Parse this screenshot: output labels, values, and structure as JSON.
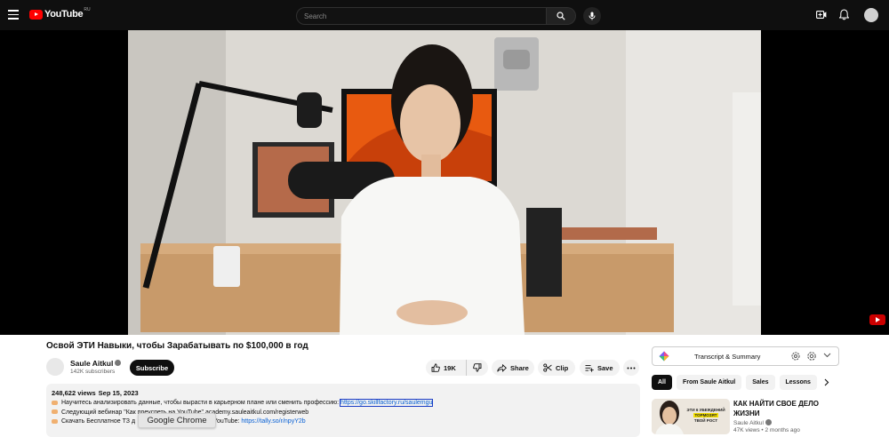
{
  "header": {
    "logo_text": "YouTube",
    "region": "RU",
    "search_placeholder": "Search"
  },
  "video": {
    "title": "Освой ЭТИ Навыки, чтобы Зарабатывать по $100,000 в год"
  },
  "channel": {
    "name": "Saule Aitkul",
    "subscribers": "142K subscribers",
    "subscribe_label": "Subscribe"
  },
  "actions": {
    "likes": "19K",
    "share_label": "Share",
    "clip_label": "Clip",
    "save_label": "Save"
  },
  "description": {
    "views": "248,622 views",
    "date": "Sep 15, 2023",
    "line1_text": "Научитесь анализировать данные, чтобы вырасти в карьерном плане или сменить профессию: ",
    "line1_link": "https://go.skillfactory.ru/saulemgu",
    "line2_text": "Следующий вебинар \"Как преуспеть на YouTube\" academy.sauleaitkul.com/registerweb",
    "line3_text_a": "Скачать Бесплатное ТЗ д",
    "line3_text_b": " YouTube: ",
    "line3_link": "https://tally.so/r/npyY2b"
  },
  "tooltip": {
    "text": "Google Chrome"
  },
  "sidebar": {
    "transcript_label": "Transcript & Summary",
    "chips": [
      "All",
      "From Saule Aitkul",
      "Sales",
      "Lessons"
    ],
    "rec": {
      "title": "КАК НАЙТИ СВОЕ ДЕЛО ЖИЗНИ",
      "channel": "Saule Aitkul",
      "meta": "47K views • 2 months ago",
      "thumb_line1": "ЭТИ 6 УБЕЖДЕНИЙ",
      "thumb_line2": "ТОРМОЗЯТ",
      "thumb_line3": "ТВОЙ РОСТ"
    }
  },
  "colors": {
    "brand_red": "#ff0000",
    "link_blue": "#065fd4",
    "topbar_bg": "#0f0f0f"
  }
}
